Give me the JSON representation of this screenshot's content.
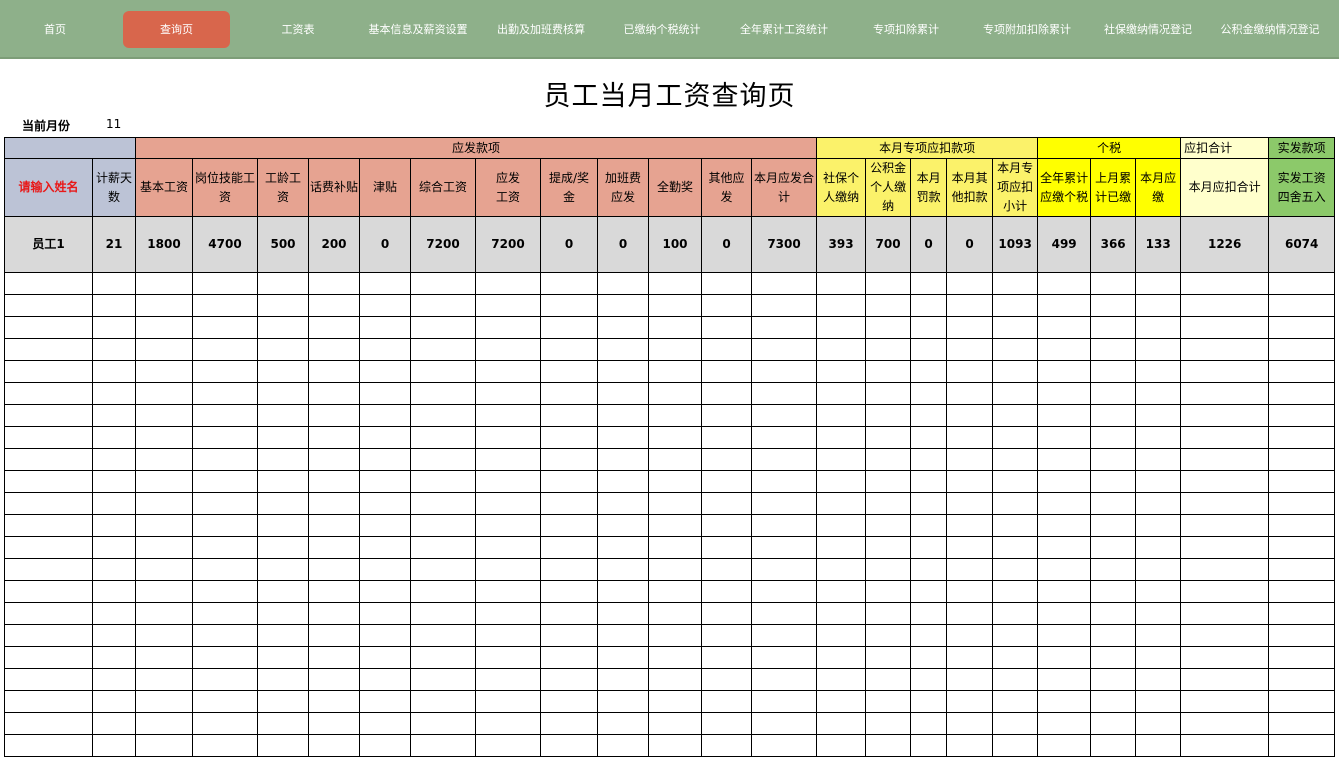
{
  "nav": {
    "items": [
      "首页",
      "查询页",
      "工资表",
      "基本信息及薪资设置",
      "出勤及加班费核算",
      "已缴纳个税统计",
      "全年累计工资统计",
      "专项扣除累计",
      "专项附加扣除累计",
      "社保缴纳情况登记",
      "公积金缴纳情况登记"
    ],
    "active": "查询页"
  },
  "page_title": "员工当月工资查询页",
  "current_month_label": "当前月份",
  "current_month_value": "11",
  "groups": {
    "payable": "应发款项",
    "special_deductions": "本月专项应扣款项",
    "tax": "个税",
    "total_deductions": "应扣合计",
    "net_pay": "实发款项"
  },
  "columns": [
    "请输入姓名",
    "计薪天\n数",
    "基本工资",
    "岗位技能工\n资",
    "工龄工\n资",
    "话费补贴",
    "津贴",
    "综合工资",
    "应发\n工资",
    "提成/奖\n金",
    "加班费\n应发",
    "全勤奖",
    "其他应\n发",
    "本月应发合\n计",
    "社保个\n人缴纳",
    "公积金\n个人缴\n纳",
    "本月\n罚款",
    "本月其\n他扣款",
    "本月专\n项应扣\n小计",
    "全年累计\n应缴个税",
    "上月累\n计已缴",
    "本月应\n缴",
    "本月应扣合计",
    "实发工资\n四舍五入"
  ],
  "employee_row": [
    "员工1",
    "21",
    "1800",
    "4700",
    "500",
    "200",
    "0",
    "7200",
    "7200",
    "0",
    "0",
    "100",
    "0",
    "7300",
    "393",
    "700",
    "0",
    "0",
    "1093",
    "499",
    "366",
    "133",
    "1226",
    "6074"
  ],
  "empty_row_count": 22,
  "colors": {
    "nav_bg": "#8eb08a",
    "nav_active": "#d8664c",
    "name_header_bg": "#bcc3d6",
    "payable_bg": "#e6a391",
    "special_bg": "#fbf26a",
    "tax_bg": "#ffff00",
    "total_bg": "#ffffcc",
    "net_bg": "#8cc96a",
    "prompt_text": "#e81919"
  }
}
